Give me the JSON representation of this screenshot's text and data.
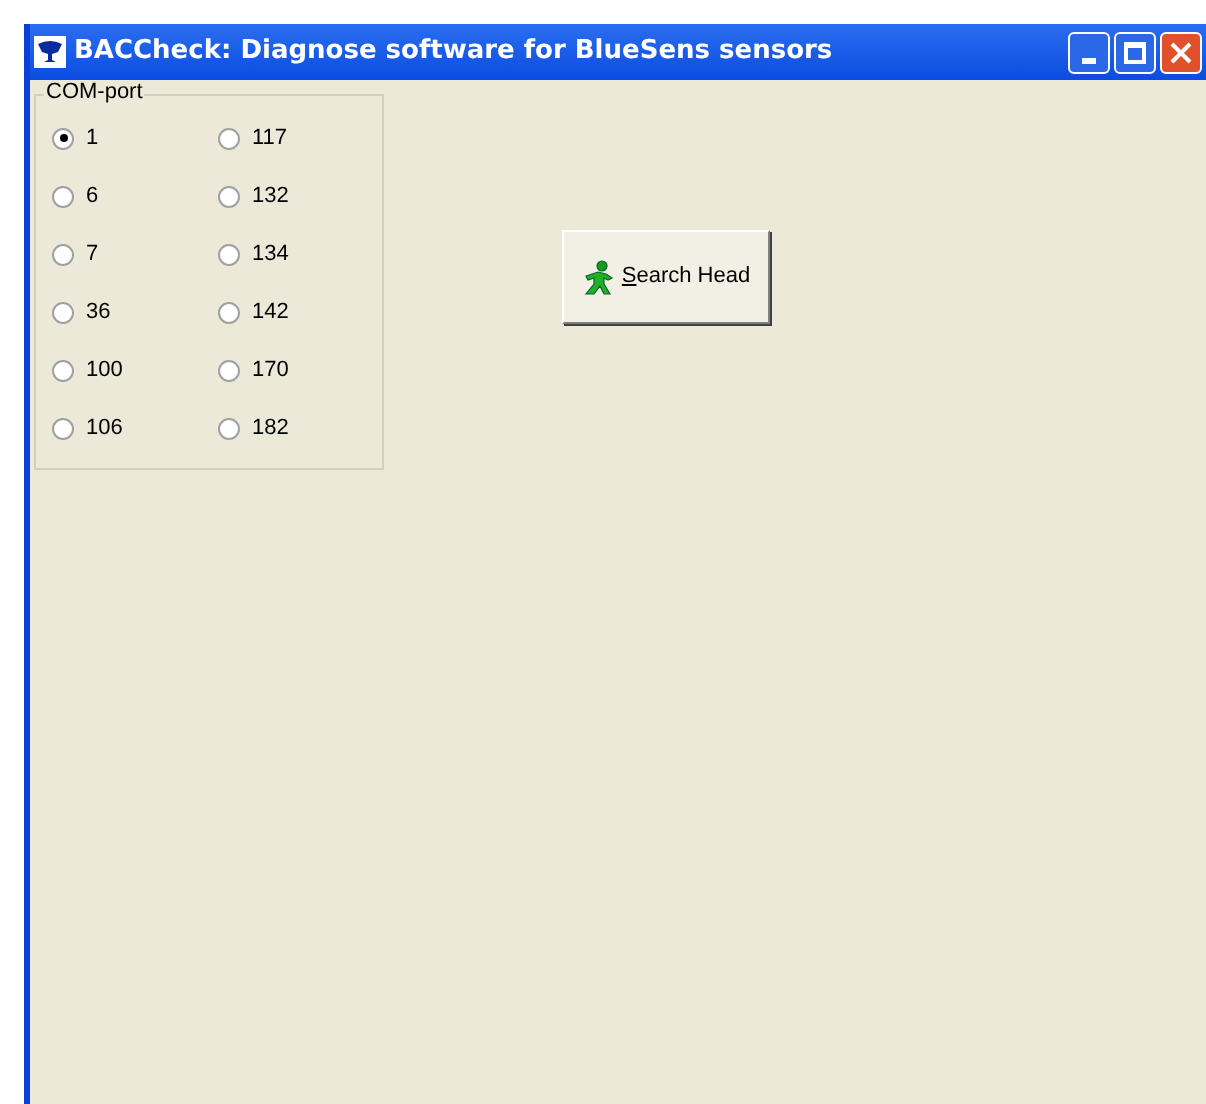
{
  "window": {
    "title": "BACCheck: Diagnose software for BlueSens sensors"
  },
  "com_port": {
    "label": "COM-port",
    "options": [
      {
        "label": "1",
        "selected": true
      },
      {
        "label": "117",
        "selected": false
      },
      {
        "label": "6",
        "selected": false
      },
      {
        "label": "132",
        "selected": false
      },
      {
        "label": "7",
        "selected": false
      },
      {
        "label": "134",
        "selected": false
      },
      {
        "label": "36",
        "selected": false
      },
      {
        "label": "142",
        "selected": false
      },
      {
        "label": "100",
        "selected": false
      },
      {
        "label": "170",
        "selected": false
      },
      {
        "label": "106",
        "selected": false
      },
      {
        "label": "182",
        "selected": false
      }
    ]
  },
  "search_button": {
    "label": "Search Head",
    "access_key_underlined": true
  }
}
